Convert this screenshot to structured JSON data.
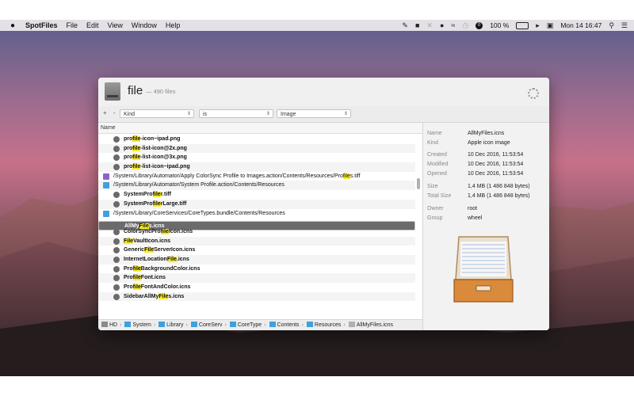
{
  "menubar": {
    "apple": "",
    "app_name": "SpotFiles",
    "menus": [
      "File",
      "Edit",
      "View",
      "Window",
      "Help"
    ],
    "status": {
      "battery_pct": "100 %",
      "datetime": "Mon 14  16:47"
    }
  },
  "window": {
    "query": "file",
    "count": "— 490 files",
    "filters": {
      "add_remove": "+ -",
      "field": "Kind",
      "operator": "is",
      "value": "Image"
    },
    "list": {
      "column_header": "Name",
      "rows": [
        {
          "type": "file",
          "pre": "pro",
          "hl": "file",
          "post": "-icon~ipad.png"
        },
        {
          "type": "file",
          "pre": "pro",
          "hl": "file",
          "post": "-list-icon@2x.png"
        },
        {
          "type": "file",
          "pre": "pro",
          "hl": "file",
          "post": "-list-icon@3x.png"
        },
        {
          "type": "file",
          "pre": "pro",
          "hl": "file",
          "post": "-list-icon~ipad.png"
        },
        {
          "type": "action",
          "pre": "/System/Library/Automator/Apply ColorSync Profile to Images.action/Contents/Resources/Pro",
          "hl": "file",
          "post": "s.tiff"
        },
        {
          "type": "folder",
          "pre": "/System/Library/Automator/System Profile.action/Contents/Resources",
          "hl": "",
          "post": ""
        },
        {
          "type": "file",
          "pre": "SystemPro",
          "hl": "file",
          "post": "r.tiff"
        },
        {
          "type": "file",
          "pre": "SystemPro",
          "hl": "file",
          "post": "rLarge.tiff"
        },
        {
          "type": "folder",
          "pre": "/System/Library/CoreServices/CoreTypes.bundle/Contents/Resources",
          "hl": "",
          "post": ""
        },
        {
          "type": "file",
          "pre": "AllMy",
          "hl": "File",
          "post": "s.icns",
          "selected": true
        },
        {
          "type": "file",
          "pre": "ColorSyncPro",
          "hl": "file",
          "post": "Icon.icns"
        },
        {
          "type": "file",
          "pre": "",
          "hl": "File",
          "post": "VaultIcon.icns"
        },
        {
          "type": "file",
          "pre": "Generic",
          "hl": "File",
          "post": "ServerIcon.icns"
        },
        {
          "type": "file",
          "pre": "InternetLocation",
          "hl": "File",
          "post": ".icns"
        },
        {
          "type": "file",
          "pre": "Pro",
          "hl": "file",
          "post": "BackgroundColor.icns"
        },
        {
          "type": "file",
          "pre": "Pro",
          "hl": "file",
          "post": "Font.icns"
        },
        {
          "type": "file",
          "pre": "Pro",
          "hl": "file",
          "post": "FontAndColor.icns"
        },
        {
          "type": "file",
          "pre": "SidebarAllMy",
          "hl": "File",
          "post": "s.icns"
        }
      ]
    },
    "pathbar": [
      "HD",
      "System",
      "Library",
      "CoreServ",
      "CoreType",
      "Contents",
      "Resources",
      "AllMyFiles.icns"
    ],
    "info": {
      "name_label": "Name",
      "name": "AllMyFiles.icns",
      "kind_label": "Kind",
      "kind": "Apple icon image",
      "created_label": "Created",
      "created": "10 Dec 2016, 11:53:54",
      "modified_label": "Modified",
      "modified": "10 Dec 2016, 11:53:54",
      "opened_label": "Opened",
      "opened": "10 Dec 2016, 11:53:54",
      "size_label": "Size",
      "size": "1,4 MB (1 486 848 bytes)",
      "total_label": "Total Size",
      "total": "1,4 MB (1 486 848 bytes)",
      "owner_label": "Owner",
      "owner": "root",
      "group_label": "Group",
      "group": "wheel"
    }
  }
}
